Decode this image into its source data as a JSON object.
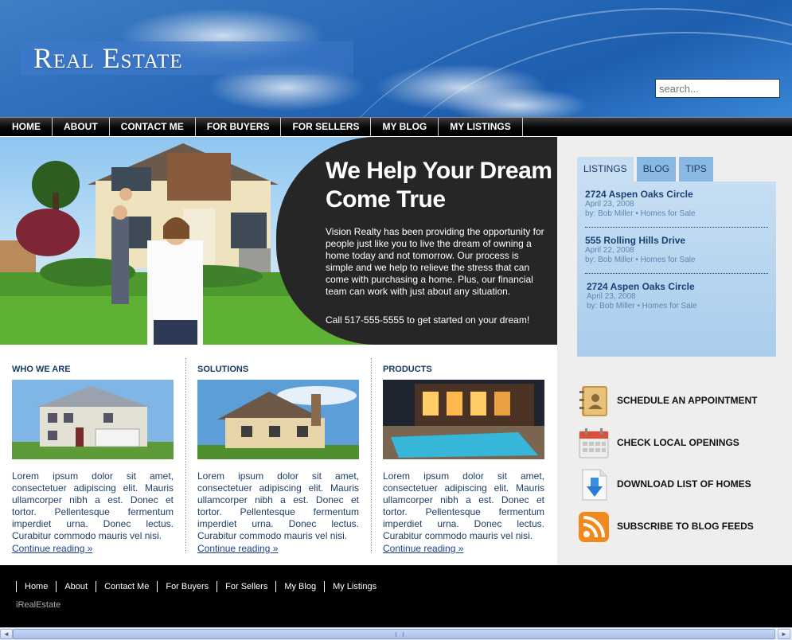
{
  "header": {
    "logo": "Real Estate",
    "search_placeholder": "search..."
  },
  "nav": {
    "items": [
      "HOME",
      "ABOUT",
      "CONTACT ME",
      "FOR BUYERS",
      "FOR SELLERS",
      "MY BLOG",
      "MY LISTINGS"
    ]
  },
  "hero": {
    "title": "We Help Your Dream Come True",
    "text": "Vision Realty has been providing the opportunity for people just like you to live the dream of owning a home today and not tomorrow. Our process is simple and we help to relieve the stress that can come with purchasing a home. Plus, our financial team can work with just about any situation.",
    "call": "Call 517-555-5555 to get started on your dream!"
  },
  "sidebar": {
    "tabs": [
      "LISTINGS",
      "BLOG",
      "TIPS"
    ],
    "listings": [
      {
        "title": "2724 Aspen Oaks Circle",
        "date": "April 23, 2008",
        "byline": "by: Bob Miller • Homes for Sale"
      },
      {
        "title": "555 Rolling Hills Drive",
        "date": "April 22, 2008",
        "byline": "by: Bob Miller • Homes for Sale"
      },
      {
        "title": "2724 Aspen Oaks Circle",
        "date": "April 23, 2008",
        "byline": "by: Bob Miller • Homes for Sale"
      }
    ],
    "actions": [
      {
        "label": "SCHEDULE AN APPOINTMENT",
        "icon": "address-book-icon"
      },
      {
        "label": "CHECK LOCAL OPENINGS",
        "icon": "calendar-icon"
      },
      {
        "label": "DOWNLOAD LIST OF HOMES",
        "icon": "download-icon"
      },
      {
        "label": "SUBSCRIBE TO BLOG FEEDS",
        "icon": "rss-icon"
      }
    ]
  },
  "columns": [
    {
      "heading": "WHO WE ARE",
      "text": "Lorem ipsum dolor sit amet, consectetuer adipiscing elit. Mauris ullamcorper nibh a est. Donec et tortor. Pellentesque fermentum imperdiet urna. Donec lectus. Curabitur commodo mauris vel nisi.",
      "more": "Continue reading »"
    },
    {
      "heading": "SOLUTIONS",
      "text": "Lorem ipsum dolor sit amet, consectetuer adipiscing elit. Mauris ullamcorper nibh a est. Donec et tortor. Pellentesque fermentum imperdiet urna. Donec lectus. Curabitur commodo mauris vel nisi.",
      "more": "Continue reading »"
    },
    {
      "heading": "PRODUCTS",
      "text": "Lorem ipsum dolor sit amet, consectetuer adipiscing elit. Mauris ullamcorper nibh a est. Donec et tortor. Pellentesque fermentum imperdiet urna. Donec lectus. Curabitur commodo mauris vel nisi.",
      "more": "Continue reading »"
    }
  ],
  "footer": {
    "links": [
      "Home",
      "About",
      "Contact Me",
      "For Buyers",
      "For Sellers",
      "My Blog",
      "My Listings"
    ],
    "brand": "iRealEstate"
  }
}
